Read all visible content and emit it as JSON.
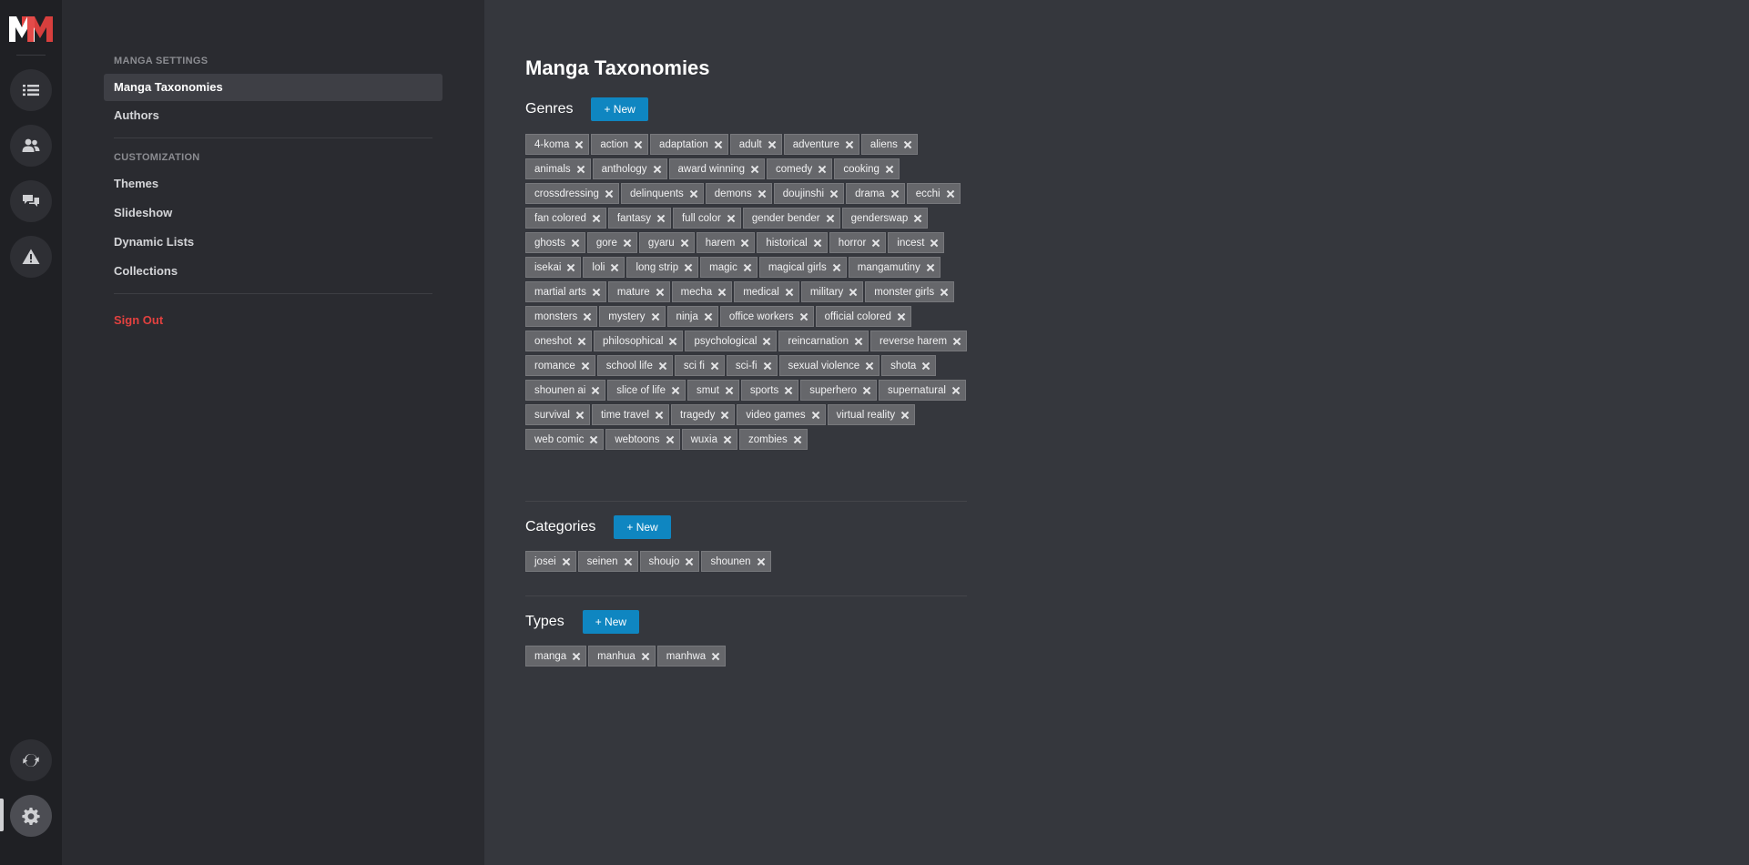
{
  "nav": {
    "sections": [
      {
        "key": "manga_settings",
        "title": "MANGA SETTINGS"
      },
      {
        "key": "customization",
        "title": "CUSTOMIZATION"
      }
    ],
    "items": [
      {
        "label": "Manga Taxonomies",
        "active": true
      },
      {
        "label": "Authors"
      },
      {
        "label": "Themes"
      },
      {
        "label": "Slideshow"
      },
      {
        "label": "Dynamic Lists"
      },
      {
        "label": "Collections"
      }
    ],
    "sign_out": "Sign Out"
  },
  "rail": {
    "icons": [
      "list-icon",
      "users-icon",
      "chat-icon",
      "warning-icon",
      "sync-icon",
      "gear-icon"
    ]
  },
  "page": {
    "title": "Manga Taxonomies"
  },
  "sections": [
    {
      "title": "Genres",
      "new_label": "+ New",
      "tags": [
        "4-koma",
        "action",
        "adaptation",
        "adult",
        "adventure",
        "aliens",
        "animals",
        "anthology",
        "award winning",
        "comedy",
        "cooking",
        "crossdressing",
        "delinquents",
        "demons",
        "doujinshi",
        "drama",
        "ecchi",
        "fan colored",
        "fantasy",
        "full color",
        "gender bender",
        "genderswap",
        "ghosts",
        "gore",
        "gyaru",
        "harem",
        "historical",
        "horror",
        "incest",
        "isekai",
        "loli",
        "long strip",
        "magic",
        "magical girls",
        "mangamutiny",
        "martial arts",
        "mature",
        "mecha",
        "medical",
        "military",
        "monster girls",
        "monsters",
        "mystery",
        "ninja",
        "office workers",
        "official colored",
        "oneshot",
        "philosophical",
        "psychological",
        "reincarnation",
        "reverse harem",
        "romance",
        "school life",
        "sci fi",
        "sci-fi",
        "sexual violence",
        "shota",
        "shounen ai",
        "slice of life",
        "smut",
        "sports",
        "superhero",
        "supernatural",
        "survival",
        "time travel",
        "tragedy",
        "video games",
        "virtual reality",
        "web comic",
        "webtoons",
        "wuxia",
        "zombies"
      ]
    },
    {
      "title": "Categories",
      "new_label": "+ New",
      "tags": [
        "josei",
        "seinen",
        "shoujo",
        "shounen"
      ]
    },
    {
      "title": "Types",
      "new_label": "+ New",
      "tags": [
        "manga",
        "manhua",
        "manhwa"
      ]
    }
  ],
  "colors": {
    "accent": "#0f86c1",
    "danger": "#e2413f",
    "tag_bg": "#66676b"
  }
}
